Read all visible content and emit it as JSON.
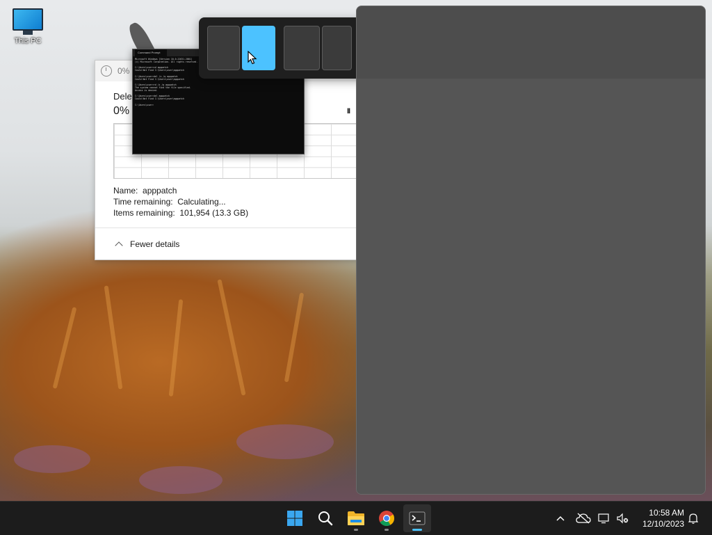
{
  "desktop": {
    "icons": [
      {
        "label": "This PC"
      }
    ]
  },
  "progress_dialog": {
    "title": "0% c",
    "operation": "Delet",
    "percent": "0%",
    "pause_glyph": "II",
    "details": {
      "name_label": "Name:",
      "name_value": "apppatch",
      "time_label": "Time remaining:",
      "time_value": "Calculating...",
      "items_label": "Items remaining:",
      "items_value": "101,954 (13.3 GB)"
    },
    "fewer_details": "Fewer details"
  },
  "terminal": {
    "tab_title": "Command Prompt",
    "lines": [
      "Microsoft Windows [Version 10.0.22631.2861]",
      "(c) Microsoft Corporation. All rights reserved.",
      "",
      "C:\\Users\\user>cd apppatch",
      "Could Not Find C:\\Users\\user\\apppatch",
      "",
      "C:\\Users\\user>del /s /q apppatch",
      "Could Not Find C:\\Users\\user\\apppatch",
      "",
      "C:\\Users\\user>rd /s /q apppatch",
      "The system cannot find the file specified.",
      "Access is denied.",
      "",
      "C:\\Users\\user>del apppatch",
      "Could Not Find C:\\Users\\user\\apppatch",
      "",
      "C:\\Users\\user>"
    ]
  },
  "snap_layouts": {
    "accent": "#4cc2ff",
    "hovered_layout": 1,
    "hovered_zone": "right-half"
  },
  "taskbar": {
    "apps": [
      "start",
      "search",
      "file-explorer",
      "chrome",
      "terminal"
    ],
    "active_app": "terminal",
    "time": "10:58 AM",
    "date": "12/10/2023"
  }
}
